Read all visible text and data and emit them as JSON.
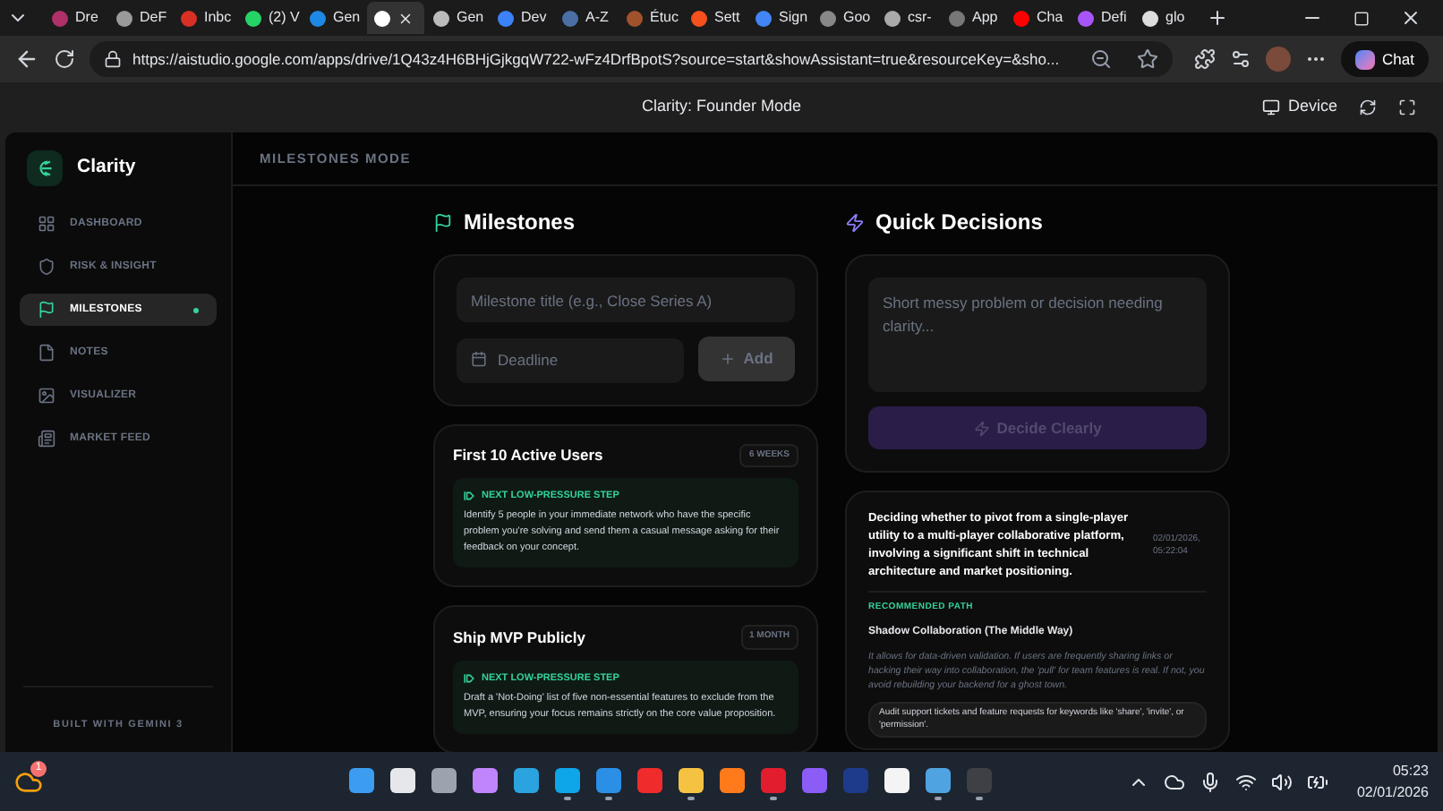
{
  "browser": {
    "tabs": [
      {
        "label": "Dre",
        "color": "#b0306a",
        "selected": false
      },
      {
        "label": "DeF",
        "color": "#9a9a9a",
        "selected": false
      },
      {
        "label": "Inbc",
        "color": "#d93025",
        "selected": false
      },
      {
        "label": "(2) V",
        "color": "#25d366",
        "selected": false
      },
      {
        "label": "Gen",
        "color": "#1e88e5",
        "selected": false
      },
      {
        "color": "#ffffff",
        "selected": true
      },
      {
        "label": "Gen",
        "color": "#bbbbbb",
        "selected": false
      },
      {
        "label": "Dev",
        "color": "#3b82f6",
        "selected": false
      },
      {
        "label": "A-Z",
        "color": "#4a6fa5",
        "selected": false
      },
      {
        "label": "Étuc",
        "color": "#a0522d",
        "selected": false
      },
      {
        "label": "Sett",
        "color": "#f4511e",
        "selected": false
      },
      {
        "label": "Sign",
        "color": "#4285f4",
        "selected": false
      },
      {
        "label": "Goo",
        "color": "#888888",
        "selected": false
      },
      {
        "label": "csr-",
        "color": "#aaaaaa",
        "selected": false
      },
      {
        "label": "App",
        "color": "#777777",
        "selected": false
      },
      {
        "label": "Cha",
        "color": "#ff0000",
        "selected": false
      },
      {
        "label": "Defi",
        "color": "#a855f7",
        "selected": false
      },
      {
        "label": "glo",
        "color": "#dddddd",
        "selected": false
      }
    ],
    "url": "https://aistudio.google.com/apps/drive/1Q43z4H6BHjGjkgqW722-wFz4DrfBpotS?source=start&showAssistant=true&resourceKey=&sho...",
    "chat_button": "Chat"
  },
  "app_header": {
    "title": "Clarity: Founder Mode",
    "device_button": "Device"
  },
  "sidebar": {
    "brand": "Clarity",
    "items": [
      {
        "label": "DASHBOARD",
        "kind": "grid",
        "selected": false
      },
      {
        "label": "RISK & INSIGHT",
        "kind": "shield",
        "selected": false
      },
      {
        "label": "MILESTONES",
        "kind": "flag",
        "selected": true
      },
      {
        "label": "NOTES",
        "kind": "file",
        "selected": false
      },
      {
        "label": "VISUALIZER",
        "kind": "image",
        "selected": false
      },
      {
        "label": "MARKET FEED",
        "kind": "news",
        "selected": false
      }
    ],
    "footer": "BUILT WITH GEMINI 3"
  },
  "page_header": "MILESTONES MODE",
  "milestones": {
    "title": "Milestones",
    "title_placeholder": "Milestone title (e.g., Close Series A)",
    "deadline_placeholder": "Deadline",
    "add_button": {
      "label": "Add",
      "disabled": true
    },
    "cards": [
      {
        "title": "First 10 Active Users",
        "badge": "6 WEEKS",
        "step_label": "NEXT LOW-PRESSURE STEP",
        "step": "Identify 5 people in your immediate network who have the specific problem you're solving and send them a casual message asking for their feedback on your concept."
      },
      {
        "title": "Ship MVP Publicly",
        "badge": "1 MONTH",
        "step_label": "NEXT LOW-PRESSURE STEP",
        "step": "Draft a 'Not-Doing' list of five non-essential features to exclude from the MVP, ensuring your focus remains strictly on the core value proposition."
      }
    ]
  },
  "quick_decisions": {
    "title": "Quick Decisions",
    "placeholder": "Short messy problem or decision needing clarity...",
    "decide_button": {
      "label": "Decide Clearly",
      "disabled": true
    },
    "decision": {
      "question": "Deciding whether to pivot from a single-player utility to a multi-player collaborative platform, involving a significant shift in technical architecture and market positioning.",
      "timestamp": "02/01/2026, 05:22:04",
      "path_label": "RECOMMENDED PATH",
      "path": "Shadow Collaboration (The Middle Way)",
      "reason": "It allows for data-driven validation. If users are frequently sharing links or hacking their way into collaboration, the 'pull' for team features is real. If not, you avoid rebuilding your backend for a ghost town.",
      "action": "Audit support tickets and feature requests for keywords like 'share', 'invite', or 'permission'."
    }
  },
  "taskbar": {
    "weather_badge": "1",
    "apps": [
      {
        "color": "#3b9cf0",
        "running": false
      },
      {
        "color": "#e5e7eb",
        "running": false
      },
      {
        "color": "#9ca3af",
        "running": false
      },
      {
        "color": "#c084fc",
        "running": false
      },
      {
        "color": "#2aa3df",
        "running": false
      },
      {
        "color": "#0ea5e9",
        "running": true
      },
      {
        "color": "#2b8fe6",
        "running": true
      },
      {
        "color": "#ef2b2b",
        "running": false
      },
      {
        "color": "#f5c242",
        "running": true
      },
      {
        "color": "#ff7a1a",
        "running": false
      },
      {
        "color": "#e11d2e",
        "running": true
      },
      {
        "color": "#8b5cf6",
        "running": false
      },
      {
        "color": "#1e3a8a",
        "running": false
      },
      {
        "color": "#f4f4f5",
        "running": false
      },
      {
        "color": "#4fa3e0",
        "running": true
      },
      {
        "color": "#3f3f46",
        "running": true
      }
    ],
    "time": "05:23",
    "date": "02/01/2026"
  }
}
